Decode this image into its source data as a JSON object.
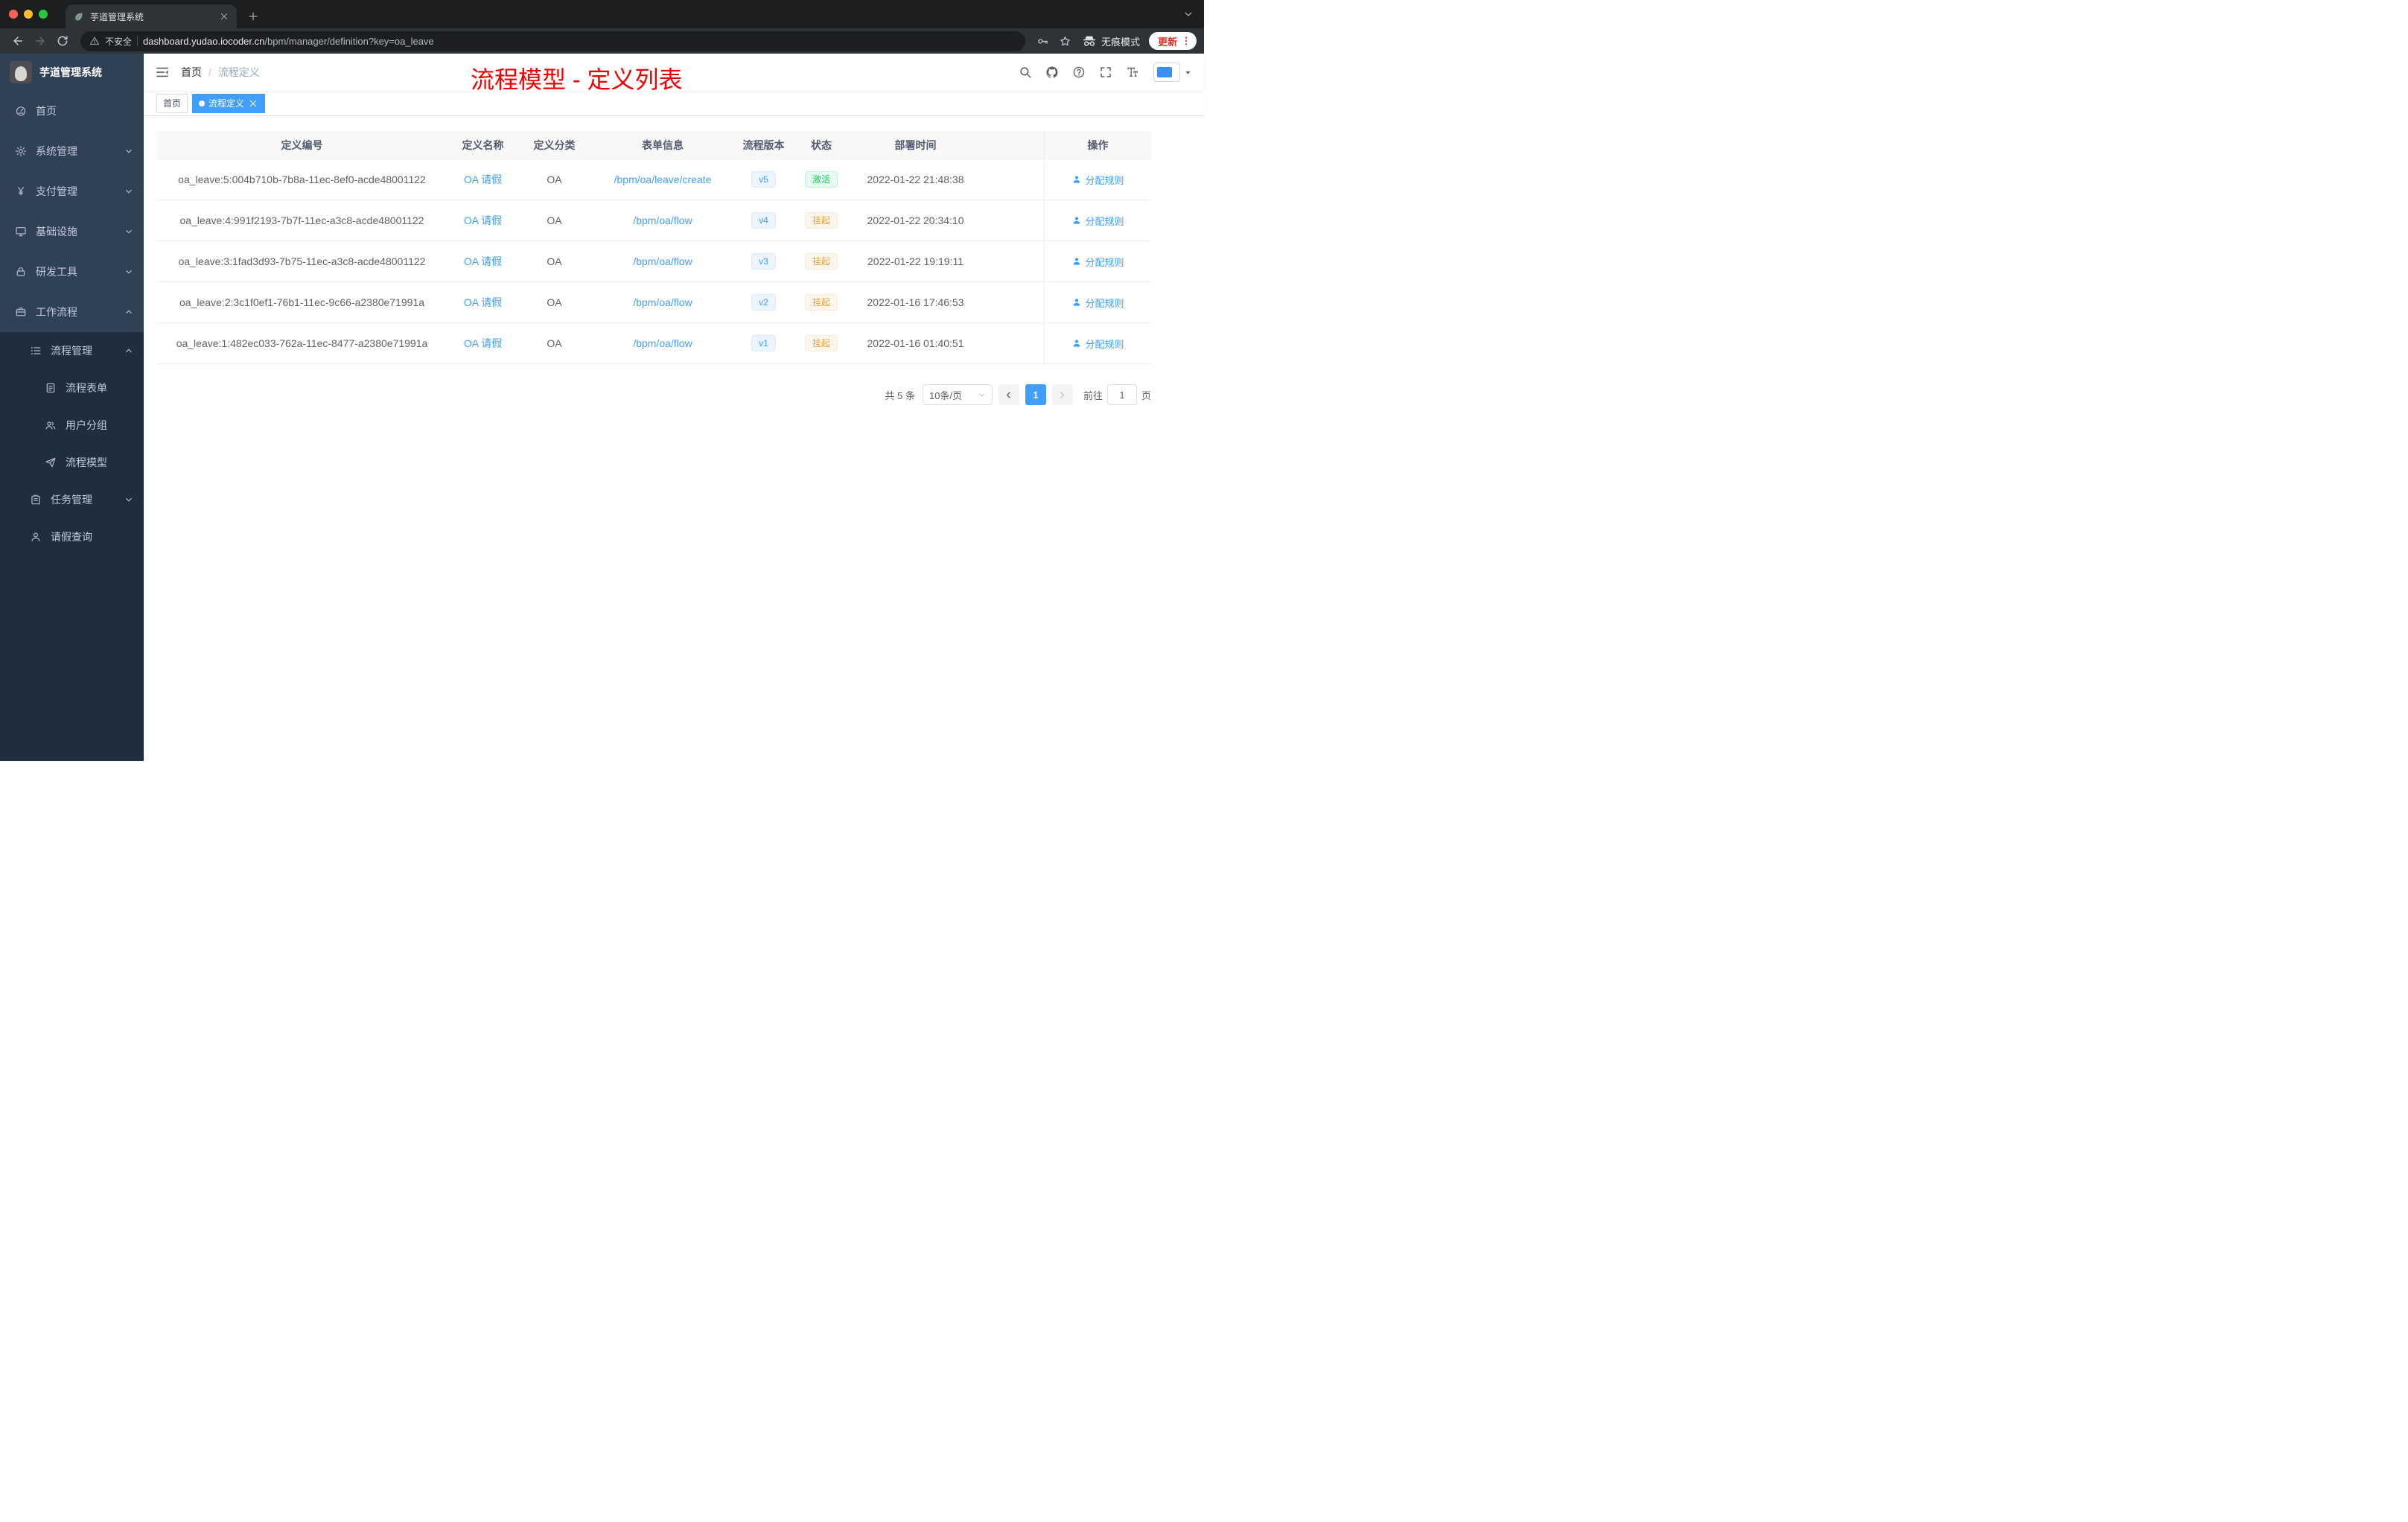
{
  "browser": {
    "tab_title": "芋道管理系统",
    "address": {
      "security_label": "不安全",
      "url_domain": "dashboard.yudao.iocoder.cn",
      "url_path": "/bpm/manager/definition?key=oa_leave",
      "incognito_label": "无痕模式",
      "update_label": "更新"
    }
  },
  "sidebar": {
    "brand": "芋道管理系统",
    "items": [
      {
        "key": "home",
        "label": "首页",
        "icon": "dashboard-icon",
        "level": 1,
        "chevron": null
      },
      {
        "key": "system-management",
        "label": "系统管理",
        "icon": "gear-icon",
        "level": 1,
        "chevron": "down"
      },
      {
        "key": "payment-management",
        "label": "支付管理",
        "icon": "yen-icon",
        "level": 1,
        "chevron": "down"
      },
      {
        "key": "infrastructure",
        "label": "基础设施",
        "icon": "monitor-icon",
        "level": 1,
        "chevron": "down"
      },
      {
        "key": "dev-tools",
        "label": "研发工具",
        "icon": "lock-icon",
        "level": 1,
        "chevron": "down"
      },
      {
        "key": "workflow",
        "label": "工作流程",
        "icon": "briefcase-icon",
        "level": 1,
        "chevron": "up"
      },
      {
        "key": "process-management",
        "label": "流程管理",
        "icon": "list-icon",
        "level": 2,
        "chevron": "up"
      },
      {
        "key": "process-form",
        "label": "流程表单",
        "icon": "form-icon",
        "level": 3,
        "chevron": null
      },
      {
        "key": "user-group",
        "label": "用户分组",
        "icon": "users-icon",
        "level": 3,
        "chevron": null
      },
      {
        "key": "process-model",
        "label": "流程模型",
        "icon": "send-icon",
        "level": 3,
        "chevron": null
      },
      {
        "key": "task-management",
        "label": "任务管理",
        "icon": "clipboard-icon",
        "level": 2,
        "chevron": "down"
      },
      {
        "key": "leave-query",
        "label": "请假查询",
        "icon": "user-icon",
        "level": 2,
        "chevron": null
      }
    ]
  },
  "navbar": {
    "breadcrumb_first": "首页",
    "breadcrumb_separator": "/",
    "breadcrumb_last": "流程定义",
    "annotation": "流程模型 - 定义列表"
  },
  "tags": [
    {
      "key": "home",
      "label": "首页",
      "active": false,
      "dot": false,
      "closable": false
    },
    {
      "key": "process-definition",
      "label": "流程定义",
      "active": true,
      "dot": true,
      "closable": true
    }
  ],
  "table": {
    "columns": [
      "定义编号",
      "定义名称",
      "定义分类",
      "表单信息",
      "流程版本",
      "状态",
      "部署时间",
      "操作"
    ],
    "rows": [
      {
        "id": "oa_leave:5:004b710b-7b8a-11ec-8ef0-acde48001122",
        "name": "OA 请假",
        "category": "OA",
        "form": "/bpm/oa/leave/create",
        "version": "v5",
        "status": "激活",
        "status_type": "success",
        "time": "2022-01-22 21:48:38",
        "action": "分配规则"
      },
      {
        "id": "oa_leave:4:991f2193-7b7f-11ec-a3c8-acde48001122",
        "name": "OA 请假",
        "category": "OA",
        "form": "/bpm/oa/flow",
        "version": "v4",
        "status": "挂起",
        "status_type": "warning",
        "time": "2022-01-22 20:34:10",
        "action": "分配规则"
      },
      {
        "id": "oa_leave:3:1fad3d93-7b75-11ec-a3c8-acde48001122",
        "name": "OA 请假",
        "category": "OA",
        "form": "/bpm/oa/flow",
        "version": "v3",
        "status": "挂起",
        "status_type": "warning",
        "time": "2022-01-22 19:19:11",
        "action": "分配规则"
      },
      {
        "id": "oa_leave:2:3c1f0ef1-76b1-11ec-9c66-a2380e71991a",
        "name": "OA 请假",
        "category": "OA",
        "form": "/bpm/oa/flow",
        "version": "v2",
        "status": "挂起",
        "status_type": "warning",
        "time": "2022-01-16 17:46:53",
        "action": "分配规则"
      },
      {
        "id": "oa_leave:1:482ec033-762a-11ec-8477-a2380e71991a",
        "name": "OA 请假",
        "category": "OA",
        "form": "/bpm/oa/flow",
        "version": "v1",
        "status": "挂起",
        "status_type": "warning",
        "time": "2022-01-16 01:40:51",
        "action": "分配规则"
      }
    ]
  },
  "pagination": {
    "total": "共 5 条",
    "page_size": "10条/页",
    "current": "1",
    "goto_label": "前往",
    "goto_value": "1",
    "unit": "页"
  },
  "colors": {
    "accent_blue": "#409eff",
    "success_green": "#13ce66",
    "warning_orange": "#e6a23c",
    "annotation_red": "#f20000",
    "sidebar_bg": "#304156",
    "submenu_bg": "#1f2d3d"
  }
}
